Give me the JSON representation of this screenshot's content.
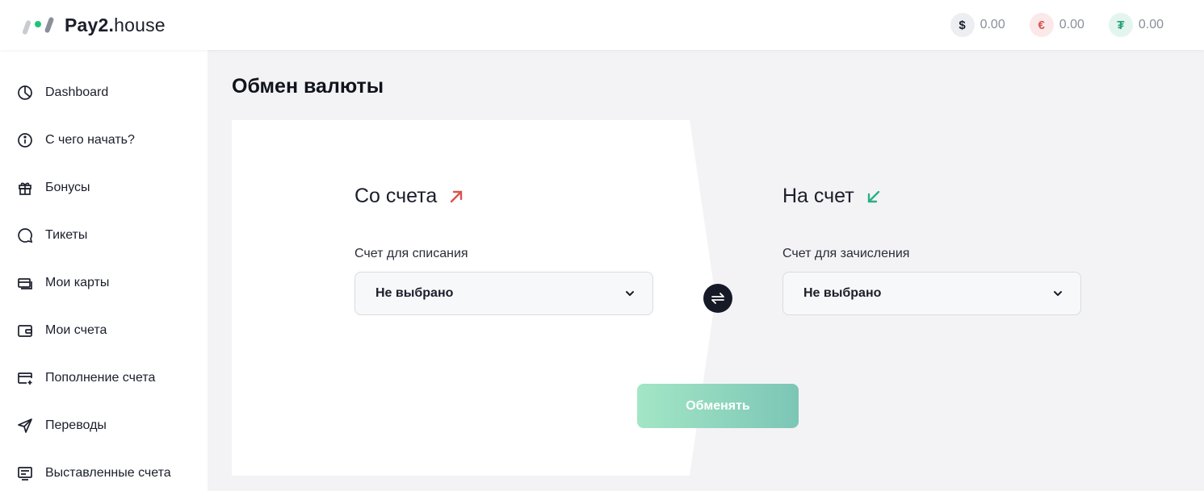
{
  "header": {
    "logo_text_bold": "Pay2.",
    "logo_text_regular": "house",
    "balances": [
      {
        "currency_icon": "dollar-icon",
        "symbol": "$",
        "value": "0.00",
        "color": "#1b1e2b"
      },
      {
        "currency_icon": "euro-icon",
        "symbol": "€",
        "value": "0.00",
        "color": "#d9534f"
      },
      {
        "currency_icon": "tether-icon",
        "symbol": "₮",
        "value": "0.00",
        "color": "#26a17b"
      }
    ]
  },
  "sidebar": {
    "items": [
      {
        "label": "Dashboard",
        "icon": "pie-chart-icon"
      },
      {
        "label": "С чего начать?",
        "icon": "info-icon"
      },
      {
        "label": "Бонусы",
        "icon": "gift-icon"
      },
      {
        "label": "Тикеты",
        "icon": "chat-bubble-icon"
      },
      {
        "label": "Мои карты",
        "icon": "cards-icon"
      },
      {
        "label": "Мои счета",
        "icon": "wallet-icon"
      },
      {
        "label": "Пополнение счета",
        "icon": "card-add-icon"
      },
      {
        "label": "Переводы",
        "icon": "send-icon"
      },
      {
        "label": "Выставленные счета",
        "icon": "invoice-icon"
      }
    ]
  },
  "main": {
    "title": "Обмен валюты",
    "from": {
      "title": "Со счета",
      "field_label": "Счет для списания",
      "value": "Не выбрано",
      "arrow_color": "#d9534f"
    },
    "to": {
      "title": "На счет",
      "field_label": "Счет для зачисления",
      "value": "Не выбрано",
      "arrow_color": "#2bb07f"
    },
    "exchange_button": "Обменять"
  },
  "colors": {
    "accent_start": "#a3e6c6",
    "accent_end": "#7cc6b6",
    "dark": "#161a26"
  }
}
